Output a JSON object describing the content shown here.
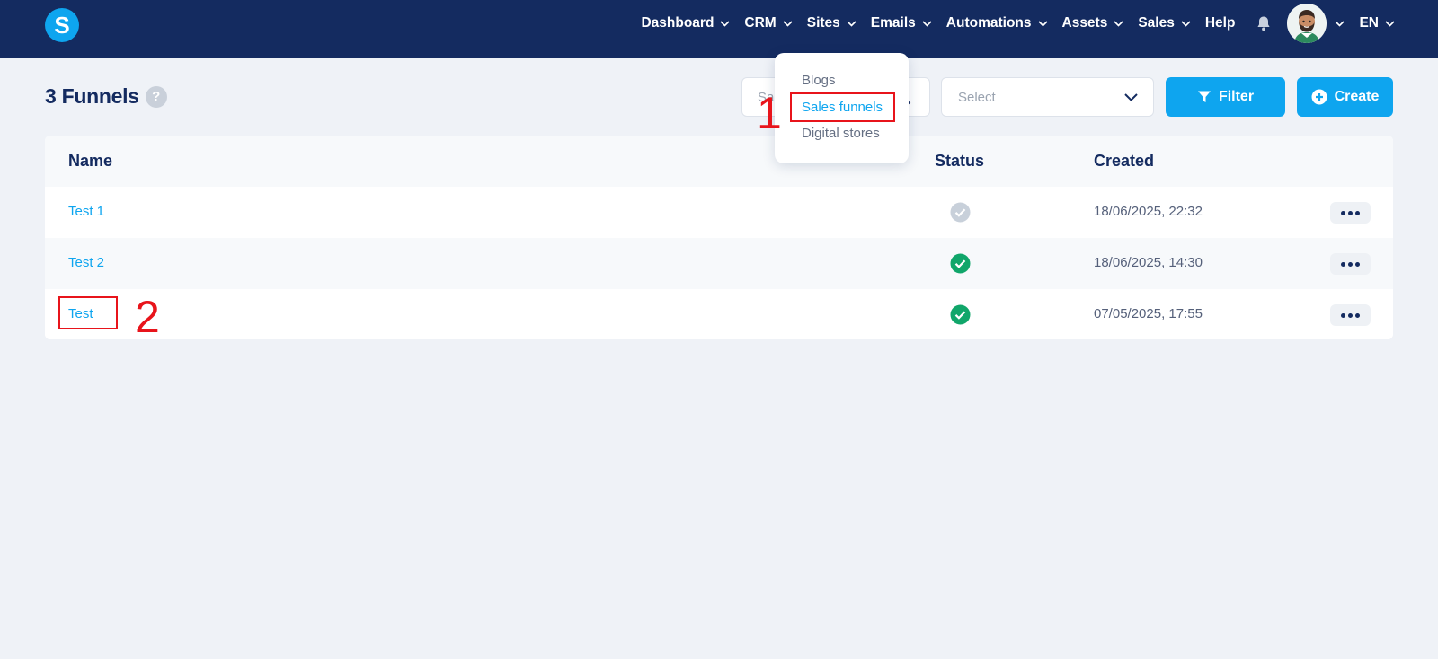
{
  "brand": {
    "logo_letter": "S",
    "accent_color": "#0ea5ef",
    "nav_bg": "#142b60"
  },
  "nav": {
    "items": [
      {
        "label": "Dashboard",
        "has_dropdown": true
      },
      {
        "label": "CRM",
        "has_dropdown": true
      },
      {
        "label": "Sites",
        "has_dropdown": true
      },
      {
        "label": "Emails",
        "has_dropdown": true
      },
      {
        "label": "Automations",
        "has_dropdown": true
      },
      {
        "label": "Assets",
        "has_dropdown": true
      },
      {
        "label": "Sales",
        "has_dropdown": true
      },
      {
        "label": "Help",
        "has_dropdown": false
      }
    ],
    "notification_icon": "bell-icon",
    "language": "EN"
  },
  "page": {
    "title": "3 Funnels",
    "help_label": "?"
  },
  "toolbar": {
    "search_placeholder": "Sa",
    "search_icon": "search-icon",
    "select_placeholder": "Select",
    "filter_label": "Filter",
    "create_label": "Create"
  },
  "table": {
    "headers": {
      "name": "Name",
      "status": "Status",
      "created": "Created"
    },
    "rows": [
      {
        "name": "Test 1",
        "status": "inactive",
        "created": "18/06/2025, 22:32"
      },
      {
        "name": "Test 2",
        "status": "active",
        "created": "18/06/2025, 14:30"
      },
      {
        "name": "Test",
        "status": "active",
        "created": "07/05/2025, 17:55"
      }
    ]
  },
  "sites_dropdown": {
    "items": [
      {
        "label": "Blogs",
        "active": false
      },
      {
        "label": "Sales funnels",
        "active": true
      },
      {
        "label": "Digital stores",
        "active": false
      }
    ]
  },
  "annotations": {
    "step_1": "1",
    "step_2": "2",
    "color": "#e8141b"
  }
}
